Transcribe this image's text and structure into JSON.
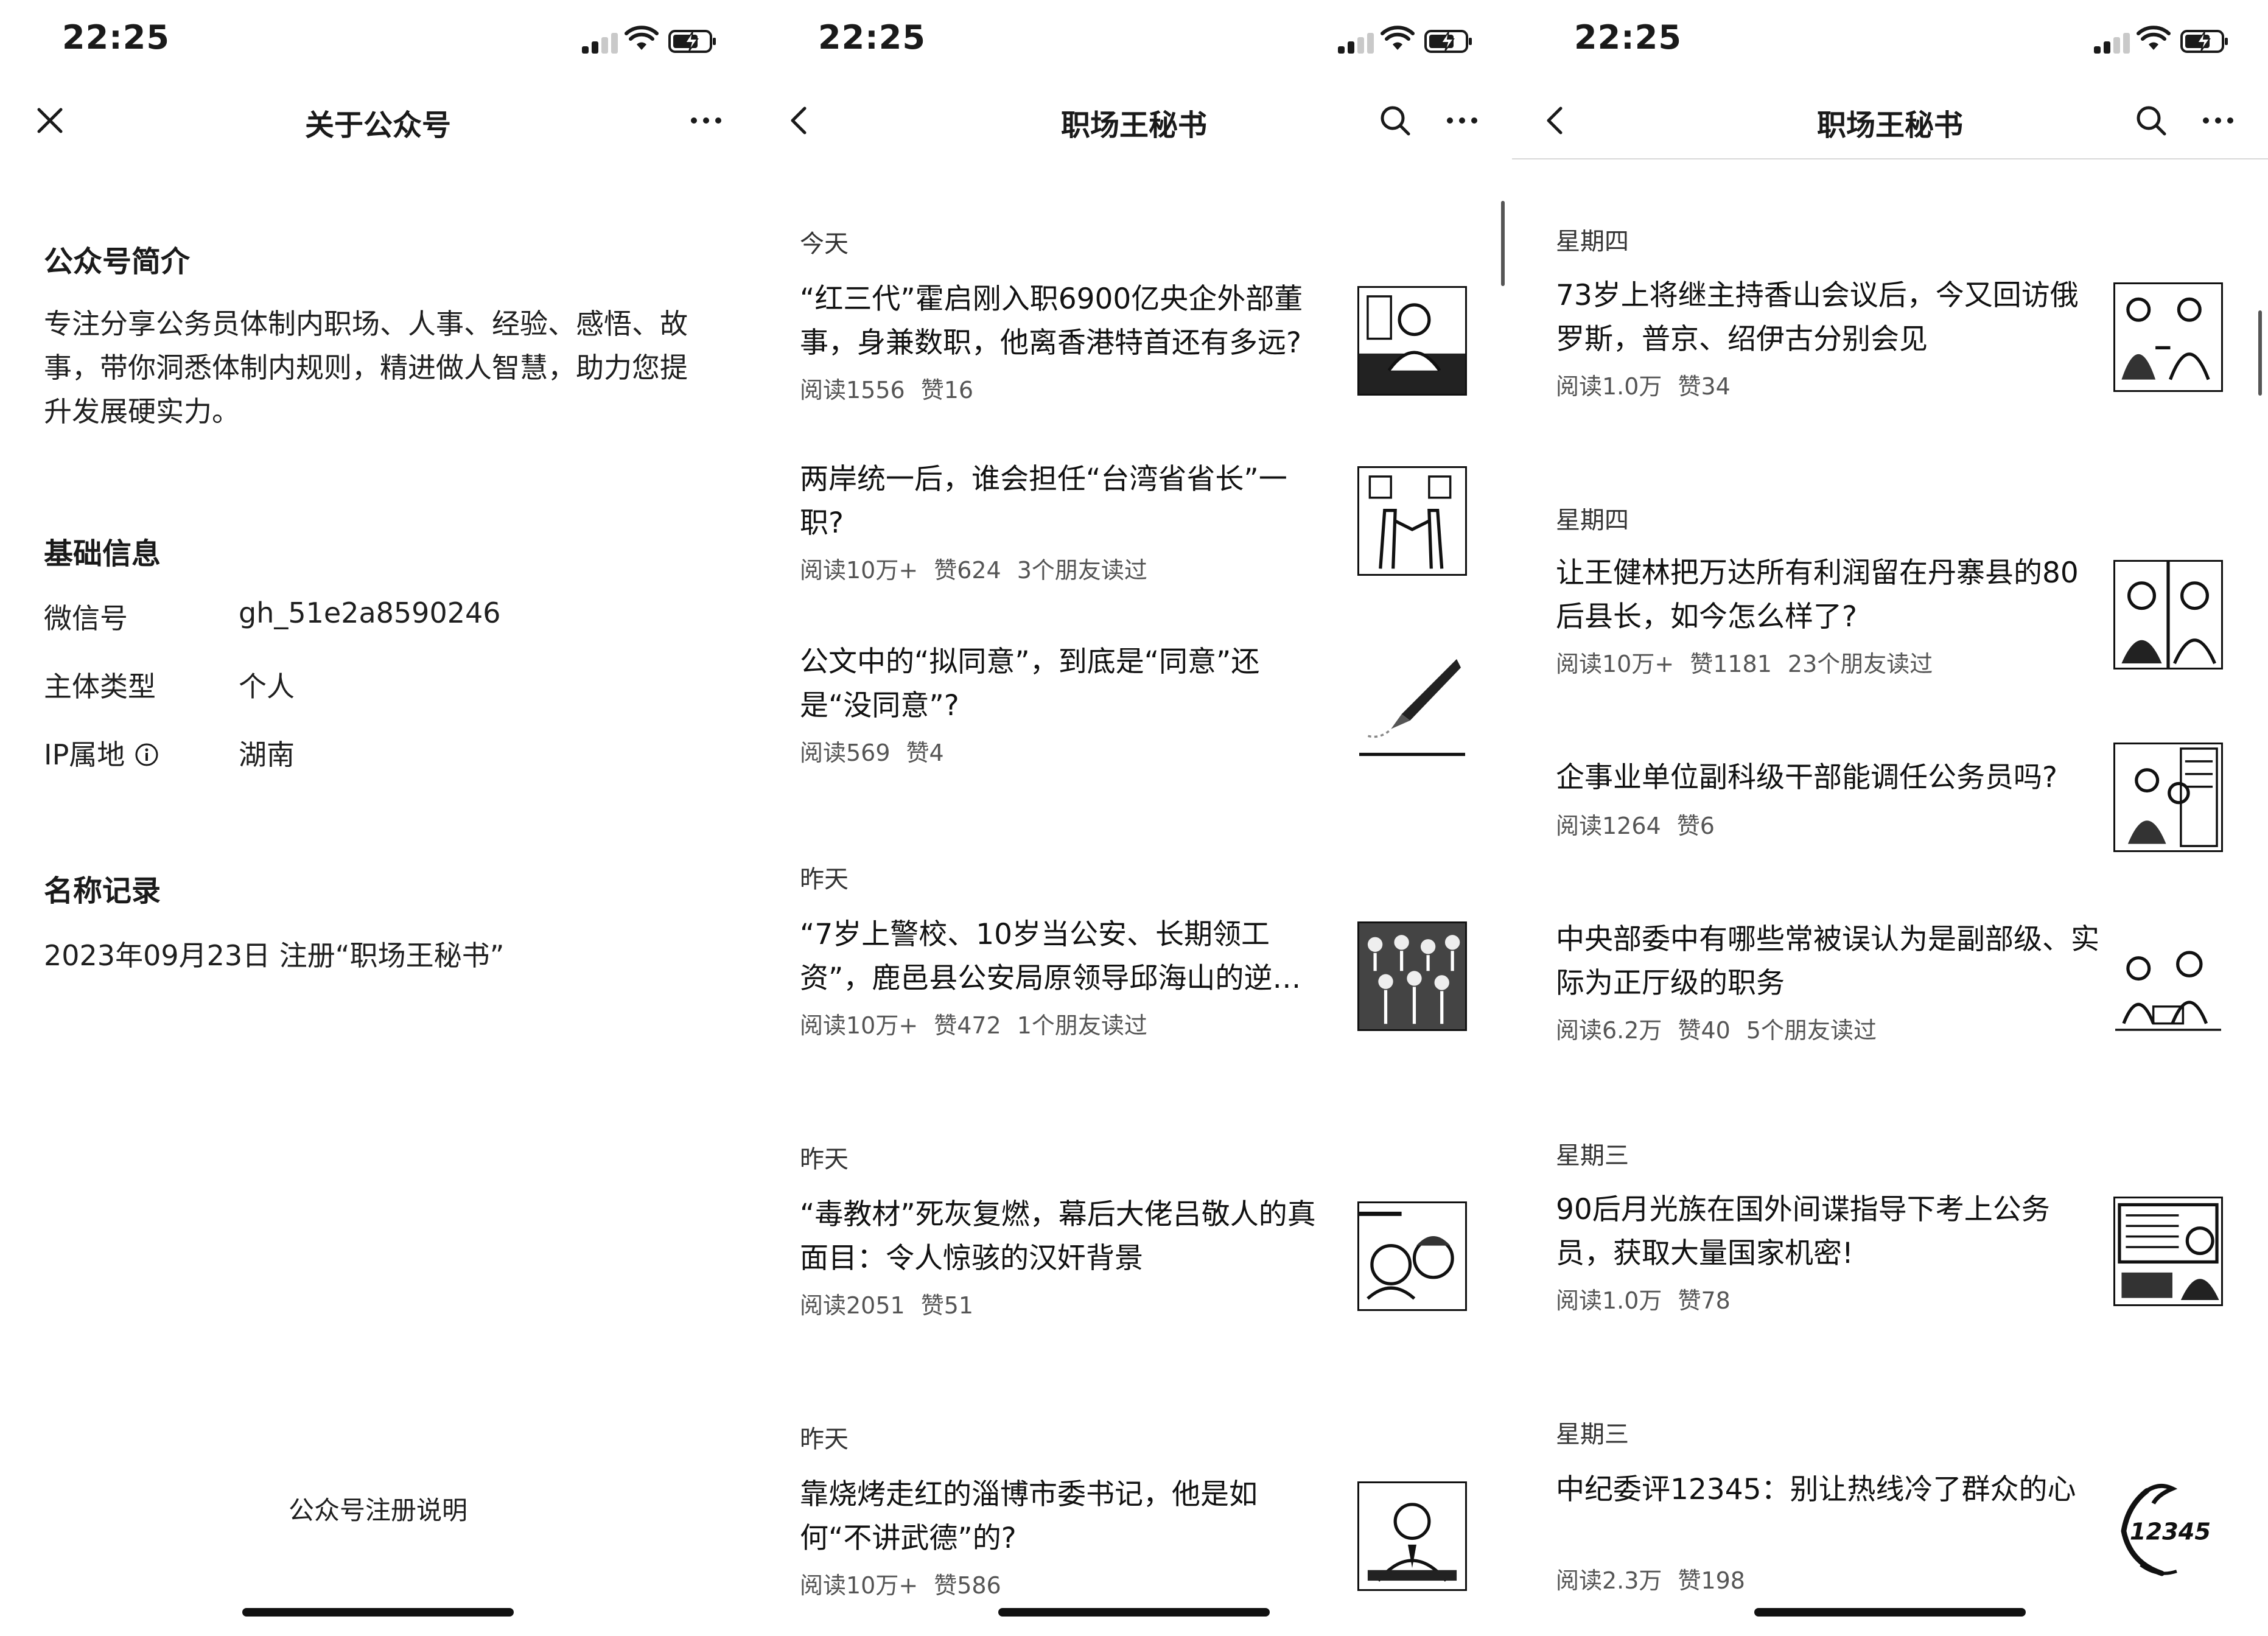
{
  "status_bar": {
    "time": "22:25"
  },
  "about_panel": {
    "nav_title": "关于公众号",
    "intro_title": "公众号简介",
    "intro_text": "专注分享公务员体制内职场、人事、经验、感悟、故事，带你洞悉体制内规则，精进做人智慧，助力您提升发展硬实力。",
    "basic_title": "基础信息",
    "wechat_label": "微信号",
    "wechat_value": "gh_51e2a8590246",
    "entity_label": "主体类型",
    "entity_value": "个人",
    "ip_label": "IP属地",
    "ip_value": "湖南",
    "history_title": "名称记录",
    "history_item": "2023年09月23日 注册“职场王秘书”",
    "register_link": "公众号注册说明"
  },
  "feed_panel_1": {
    "nav_title": "职场王秘书",
    "sections": [
      {
        "header": "今天",
        "articles": [
          {
            "title": "“红三代”霍启刚入职6900亿央企外部董事，身兼数职，他离香港特首还有多远?",
            "reads": "阅读1556",
            "likes": "赞16",
            "friends": ""
          },
          {
            "title": "两岸统一后，谁会担任“台湾省省长”一职?",
            "reads": "阅读10万+",
            "likes": "赞624",
            "friends": "3个朋友读过"
          },
          {
            "title": "公文中的“拟同意”，到底是“同意”还是“没同意”?",
            "reads": "阅读569",
            "likes": "赞4",
            "friends": ""
          }
        ]
      },
      {
        "header": "昨天",
        "articles": [
          {
            "title": "“7岁上警校、10岁当公安、长期领工资”，鹿邑县公安局原领导邱海山的逆…",
            "reads": "阅读10万+",
            "likes": "赞472",
            "friends": "1个朋友读过"
          }
        ]
      },
      {
        "header": "昨天",
        "articles": [
          {
            "title": "“毒教材”死灰复燃，幕后大佬吕敬人的真面目：令人惊骇的汉奸背景",
            "reads": "阅读2051",
            "likes": "赞51",
            "friends": ""
          }
        ]
      },
      {
        "header": "昨天",
        "articles": [
          {
            "title": "靠烧烤走红的淄博市委书记，他是如何“不讲武德”的?",
            "reads": "阅读10万+",
            "likes": "赞586",
            "friends": ""
          }
        ]
      }
    ]
  },
  "feed_panel_2": {
    "nav_title": "职场王秘书",
    "sections": [
      {
        "header": "星期四",
        "articles": [
          {
            "title": "73岁上将继主持香山会议后，今又回访俄罗斯，普京、绍伊古分别会见",
            "reads": "阅读1.0万",
            "likes": "赞34",
            "friends": ""
          }
        ]
      },
      {
        "header": "星期四",
        "articles": [
          {
            "title": "让王健林把万达所有利润留在丹寨县的80后县长，如今怎么样了?",
            "reads": "阅读10万+",
            "likes": "赞1181",
            "friends": "23个朋友读过"
          },
          {
            "title": "企事业单位副科级干部能调任公务员吗?",
            "reads": "阅读1264",
            "likes": "赞6",
            "friends": ""
          },
          {
            "title": "中央部委中有哪些常被误认为是副部级、实际为正厅级的职务",
            "reads": "阅读6.2万",
            "likes": "赞40",
            "friends": "5个朋友读过"
          }
        ]
      },
      {
        "header": "星期三",
        "articles": [
          {
            "title": "90后月光族在国外间谍指导下考上公务员，获取大量国家机密!",
            "reads": "阅读1.0万",
            "likes": "赞78",
            "friends": ""
          }
        ]
      },
      {
        "header": "星期三",
        "articles": [
          {
            "title": "中纪委评12345：别让热线冷了群众的心",
            "reads": "阅读2.3万",
            "likes": "赞198",
            "friends": ""
          }
        ]
      }
    ],
    "hotline_badge": "12345"
  }
}
